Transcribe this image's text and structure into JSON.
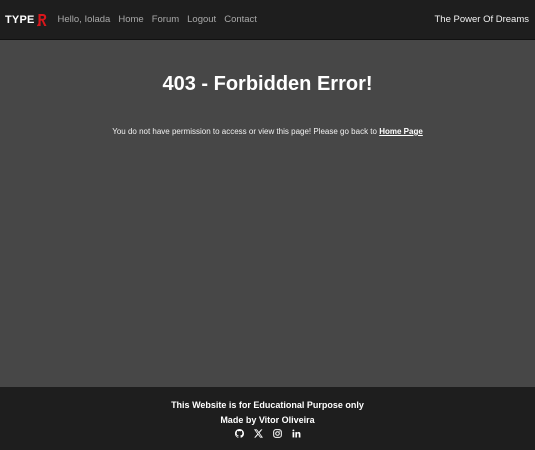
{
  "header": {
    "brand": "TYPE",
    "brand_accent_color": "#d9161b",
    "nav": [
      {
        "label": "Hello, Iolada"
      },
      {
        "label": "Home"
      },
      {
        "label": "Forum"
      },
      {
        "label": "Logout"
      },
      {
        "label": "Contact"
      }
    ],
    "tagline": "The Power Of Dreams"
  },
  "main": {
    "title": "403 - Forbidden Error!",
    "message": "You do not have permission to access or view this page! Please go back to",
    "home_link": "Home Page"
  },
  "footer": {
    "line1": "This Website is for Educational Purpose only",
    "line2": "Made by Vitor Oliveira",
    "socials": [
      "github-icon",
      "x-icon",
      "instagram-icon",
      "linkedin-icon"
    ]
  },
  "colors": {
    "navbar_bg": "#1e1e1e",
    "page_bg": "#474747",
    "nav_link": "#a9a9a9",
    "text": "#ffffff"
  }
}
